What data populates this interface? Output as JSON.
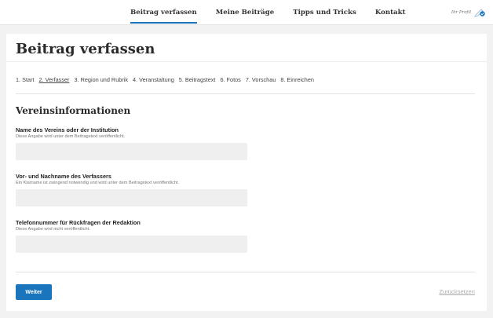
{
  "nav": {
    "items": [
      {
        "label": "Beitrag verfassen",
        "active": true
      },
      {
        "label": "Meine Beiträge",
        "active": false
      },
      {
        "label": "Tipps und Tricks",
        "active": false
      },
      {
        "label": "Kontakt",
        "active": false
      }
    ],
    "profile_label": "Ihr Profil",
    "profile_icon": "pen-check-icon"
  },
  "page": {
    "title": "Beitrag verfassen"
  },
  "steps": [
    {
      "label": "1. Start",
      "current": false
    },
    {
      "label": "2. Verfasser",
      "current": true
    },
    {
      "label": "3. Region und Rubrik",
      "current": false
    },
    {
      "label": "4. Veranstaltung",
      "current": false
    },
    {
      "label": "5. Beitragstext",
      "current": false
    },
    {
      "label": "6. Fotos",
      "current": false
    },
    {
      "label": "7. Vorschau",
      "current": false
    },
    {
      "label": "8. Einreichen",
      "current": false
    }
  ],
  "section": {
    "title": "Vereinsinformationen"
  },
  "fields": {
    "verein": {
      "label": "Name des Vereins oder der Institution",
      "hint": "Diese Angabe wird unter dem Beitragstext veröffentlicht.",
      "value": ""
    },
    "verfasser": {
      "label": "Vor- und Nachname des Verfassers",
      "hint": "Ein Klarname ist zwingend notwendig und wird unter dem Beitragstext veröffentlicht.",
      "value": ""
    },
    "telefon": {
      "label": "Telefonnummer für Rückfragen der Redaktion",
      "hint": "Diese Angabe wird nicht veröffentlicht.",
      "value": ""
    }
  },
  "actions": {
    "next_label": "Weiter",
    "reset_label": "Zurücksetzen"
  },
  "colors": {
    "accent": "#1b75bc",
    "background": "#f2f2f2",
    "input_bg": "#efefef"
  }
}
